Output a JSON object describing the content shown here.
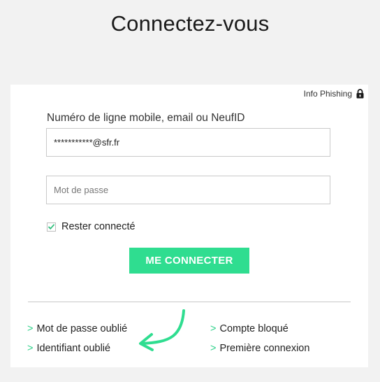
{
  "page": {
    "title": "Connectez-vous"
  },
  "card": {
    "phishing_label": "Info Phishing",
    "login_label": "Numéro de ligne mobile, email ou NeufID",
    "email_value": "***********@sfr.fr",
    "password_placeholder": "Mot de passe",
    "remember_label": "Rester connecté",
    "remember_checked": true,
    "submit_label": "ME CONNECTER"
  },
  "links": {
    "chevron": ">",
    "forgot_password": "Mot de passe oublié",
    "forgot_identifier": "Identifiant oublié",
    "account_blocked": "Compte bloqué",
    "first_login": "Première connexion"
  },
  "colors": {
    "accent": "#2fdd90",
    "background": "#f2f2f2",
    "card": "#ffffff"
  },
  "icons": {
    "phishing": "lock-icon",
    "remember": "checkmark-icon",
    "annotation": "hand-drawn-arrow-icon"
  }
}
